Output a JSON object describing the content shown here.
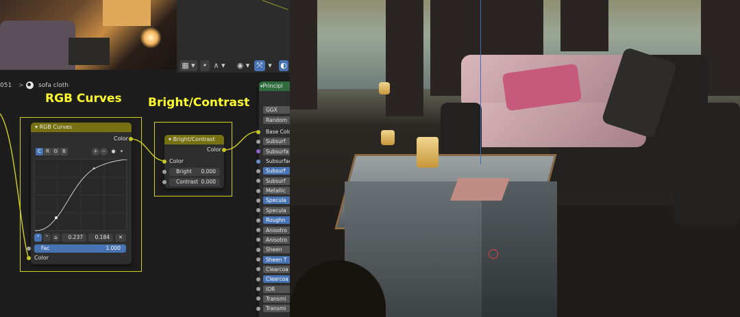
{
  "header": {
    "breadcrumb_num": "051",
    "breadcrumb_sep": ">",
    "material_name": "sofa cloth",
    "icons": [
      "sphere-icon",
      "grid-snap-icon",
      "dropdown-icon",
      "proportional-icon",
      "falloff-icon",
      "overlay-icon",
      "xray-icon"
    ]
  },
  "annotations": {
    "rgb_curves": "RGB Curves",
    "bright_contrast": "Bright/Contrast"
  },
  "rgb_curves_node": {
    "title": "RGB Curves",
    "output_color": "Color",
    "channels": [
      "C",
      "R",
      "G",
      "B"
    ],
    "point_x": "0.237",
    "point_y": "0.184",
    "fac_label": "Fac",
    "fac_value": "1.000",
    "input_color": "Color"
  },
  "bright_contrast_node": {
    "title": "Bright/Contrast",
    "output_color": "Color",
    "input_color": "Color",
    "bright_label": "Bright",
    "bright_value": "0.000",
    "contrast_label": "Contrast",
    "contrast_value": "0.000"
  },
  "principled_node": {
    "title": "Principl",
    "distribution": "GGX",
    "subsurface_method": "Random",
    "rows": [
      {
        "label": "Base Color",
        "style": "plain"
      },
      {
        "label": "Subsurf",
        "style": "gray"
      },
      {
        "label": "Subsurfa",
        "style": "gray"
      },
      {
        "label": "Subsurfac",
        "style": "plain"
      },
      {
        "label": "Subsurf",
        "style": "blue"
      },
      {
        "label": "Subsurf",
        "style": "gray"
      },
      {
        "label": "Metallic",
        "style": "gray"
      },
      {
        "label": "Specula",
        "style": "blue"
      },
      {
        "label": "Specula",
        "style": "gray"
      },
      {
        "label": "Roughn",
        "style": "blue"
      },
      {
        "label": "Anisotro",
        "style": "gray"
      },
      {
        "label": "Anisotro",
        "style": "gray"
      },
      {
        "label": "Sheen",
        "style": "gray"
      },
      {
        "label": "Sheen T",
        "style": "blue"
      },
      {
        "label": "Clearcoa",
        "style": "gray"
      },
      {
        "label": "Clearcoa",
        "style": "blue"
      },
      {
        "label": "IOR",
        "style": "gray"
      },
      {
        "label": "Transmi",
        "style": "gray"
      },
      {
        "label": "Transmi",
        "style": "gray"
      }
    ]
  },
  "colors": {
    "annotation": "#ffff2e",
    "node_header_color": "#767013",
    "node_header_shader": "#2f6b3d",
    "accent_blue": "#4772b3",
    "socket_yellow": "#c7c729"
  }
}
